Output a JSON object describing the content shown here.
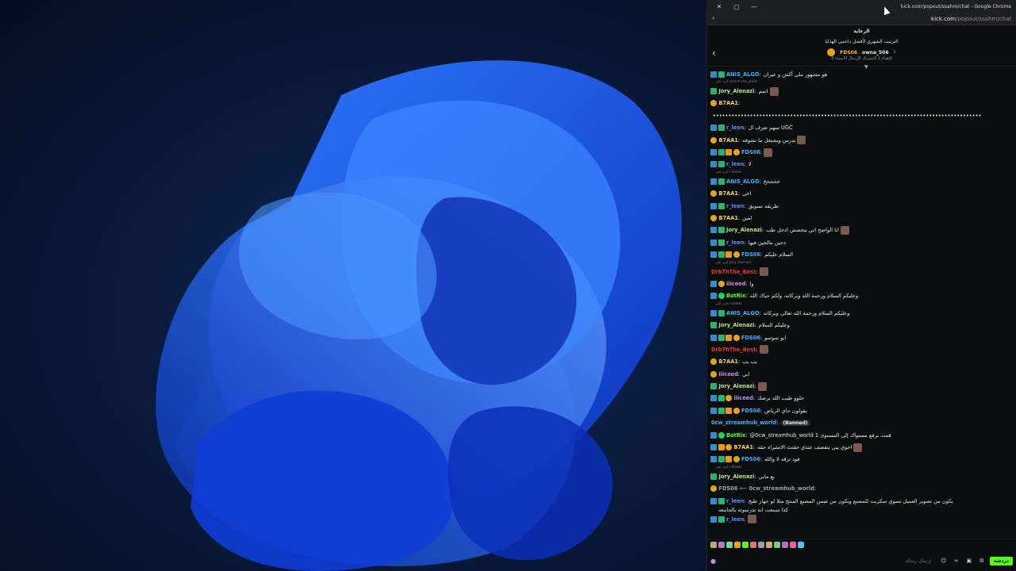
{
  "window": {
    "title": "kick.com/popout/ssahm/chat - Google Chrome",
    "url_host": "kick.com",
    "url_path": "/popout/ssahm/chat"
  },
  "pinned": {
    "label": "الرعاية",
    "subtitle": "الترتيب الشهري لأفضل داعمي الهدايا",
    "user1": "FDS06",
    "user2": "owna_506",
    "count": "1",
    "meta": "الإهداء 1 الاشتراك الإرسال الأسماء 3"
  },
  "colors": {
    "kick_green": "#53fc18",
    "mod_badge": "#2c8fd6",
    "og_badge": "#e3a61b"
  },
  "messages": [
    {
      "user": "ANIS_ALGO",
      "color": "#3bb0ff",
      "badges": [
        "mod",
        "vip"
      ],
      "text": "هو مشهور ملي أكش و عيران"
    },
    {
      "reply": "الرد على Drb7hThe_Best:"
    },
    {
      "user": "Jory_Alenazi",
      "color": "#b6e388",
      "badges": [
        "vip"
      ],
      "text": "اتمم",
      "emote": true
    },
    {
      "user": "B7AA1",
      "color": "#f3d35d",
      "badges": [
        "og"
      ],
      "text": ""
    },
    {
      "user": "",
      "color": "#e8e8e8",
      "badges": [],
      "text": "•••••••••••••••••••••••••••••••••••••••••••••••••••••••••••••••••••••••••••••••••••••••"
    },
    {
      "user": "r_leen",
      "color": "#5b8cff",
      "badges": [
        "mod",
        "vip"
      ],
      "text": "سهم تعرف ال UGC"
    },
    {
      "user": "B7AA1",
      "color": "#f3d35d",
      "badges": [
        "og"
      ],
      "text": "يدرس ويشتغل ما تشوفه",
      "emote": true
    },
    {
      "user": "FDS06",
      "color": "#3bb0ff",
      "badges": [
        "mod",
        "vip",
        "crown",
        "og"
      ],
      "text": "",
      "emote": true
    },
    {
      "user": "r_leen",
      "color": "#5b8cff",
      "badges": [
        "mod",
        "vip"
      ],
      "text": "لا"
    },
    {
      "reply": "الرد على FDS06:"
    },
    {
      "user": "ANIS_ALGO",
      "color": "#3bb0ff",
      "badges": [
        "mod",
        "vip"
      ],
      "text": "خخخخخ"
    },
    {
      "user": "B7AA1",
      "color": "#f3d35d",
      "badges": [
        "og"
      ],
      "text": "اخي"
    },
    {
      "user": "r_leen",
      "color": "#5b8cff",
      "badges": [
        "mod",
        "vip"
      ],
      "text": "طريقه تسويق"
    },
    {
      "user": "B7AA1",
      "color": "#f3d35d",
      "badges": [
        "og"
      ],
      "text": "امين"
    },
    {
      "user": "Jory_Alenazi",
      "color": "#b6e388",
      "badges": [
        "mod",
        "vip"
      ],
      "text": "انا الواضح اني بتخصص ادخل طب",
      "emote": true
    },
    {
      "user": "r_leen",
      "color": "#5b8cff",
      "badges": [
        "mod",
        "vip"
      ],
      "text": "دحين مالجين فيها"
    },
    {
      "user": "FDS06",
      "color": "#3bb0ff",
      "badges": [
        "mod",
        "vip",
        "crown",
        "og"
      ],
      "text": "السلام عليكم"
    },
    {
      "reply": "الرد على Jory_Alenazi:"
    },
    {
      "user": "Drb7hThe_Best",
      "color": "#e53935",
      "badges": [],
      "text": "",
      "emote": true
    },
    {
      "user": "iiiceed",
      "color": "#c792ea",
      "badges": [
        "mod",
        "og"
      ],
      "text": "وا"
    },
    {
      "user": "BotRix",
      "color": "#53fc18",
      "badges": [
        "mod",
        "ver"
      ],
      "text": "وعليكم السلام ورحمة الله وبركاته، ولكم حياك الله"
    },
    {
      "reply": "الرد على FDS06:"
    },
    {
      "user": "ANIS_ALGO",
      "color": "#3bb0ff",
      "badges": [
        "mod",
        "vip"
      ],
      "text": "وعليكم السلام ورحمة الله تعالى وبركاته"
    },
    {
      "user": "Jory_Alenazi",
      "color": "#b6e388",
      "badges": [
        "vip"
      ],
      "text": "وعليكم السلام"
    },
    {
      "user": "FDS06",
      "color": "#3bb0ff",
      "badges": [
        "mod",
        "vip",
        "crown",
        "og"
      ],
      "text": "انو سوسو"
    },
    {
      "user": "Drb7hThe_Best",
      "color": "#e53935",
      "badges": [],
      "text": "",
      "emote": true
    },
    {
      "user": "B7AA1",
      "color": "#f3d35d",
      "badges": [
        "og"
      ],
      "text": "بب بب"
    },
    {
      "user": "iiiceed",
      "color": "#c792ea",
      "badges": [
        "og"
      ],
      "text": "ابي"
    },
    {
      "user": "Jory_Alenazi",
      "color": "#b6e388",
      "badges": [
        "vip"
      ],
      "text": "",
      "emote": true
    },
    {
      "user": "iiiceed",
      "color": "#c792ea",
      "badges": [
        "mod",
        "vip",
        "og"
      ],
      "text": "خلوو طيب الله يرضك"
    },
    {
      "user": "FDS06",
      "color": "#3bb0ff",
      "badges": [
        "mod",
        "vip",
        "crown",
        "og"
      ],
      "text": "يقولون جاي الرياض"
    },
    {
      "user": "0cw_streamhub_world",
      "color": "#3bb0ff",
      "badges": [],
      "text": "",
      "banned": "(Banned)"
    },
    {
      "user": "BotRix",
      "color": "#53fc18",
      "badges": [
        "mod",
        "ver"
      ],
      "text": "@0cw_streamhub_world 1 قمت برفع مستواك إلى المستوى"
    },
    {
      "user": "B7AA1",
      "color": "#f3d35d",
      "badges": [
        "mod",
        "crown",
        "og"
      ],
      "text": "اخوي يبي يتفضف عندي حقتث الاتشراء حقه",
      "emote": true
    },
    {
      "user": "FDS06",
      "color": "#3bb0ff",
      "badges": [
        "mod",
        "vip",
        "crown",
        "og"
      ],
      "text": "فود ترقه لا والله"
    },
    {
      "reply": "الرد على FDS06:"
    },
    {
      "user": "Jory_Alenazi",
      "color": "#b6e388",
      "badges": [
        "vip"
      ],
      "text": "بع مابي"
    },
    {
      "user": "FDS06 ⟵ 0cw_streamhub_world",
      "color": "#9aa0a6",
      "badges": [
        "og"
      ],
      "text": ""
    },
    {
      "user": "r_leen",
      "color": "#5b8cff",
      "badges": [
        "mod",
        "vip"
      ],
      "text": "يكون من تصوير العميل تسوي سكربت للمصنع ويكون من ضمن المصنع المنتج مثلا لو جهاز طبخ"
    },
    {
      "wrap": "كذا سمعت انه تدرسوته بالجامعه"
    },
    {
      "user": "r_leen",
      "color": "#5b8cff",
      "badges": [
        "mod",
        "vip"
      ],
      "text": "",
      "emote": true
    }
  ],
  "input": {
    "placeholder": "إرسال رسالة",
    "send_label": "دردشة"
  }
}
